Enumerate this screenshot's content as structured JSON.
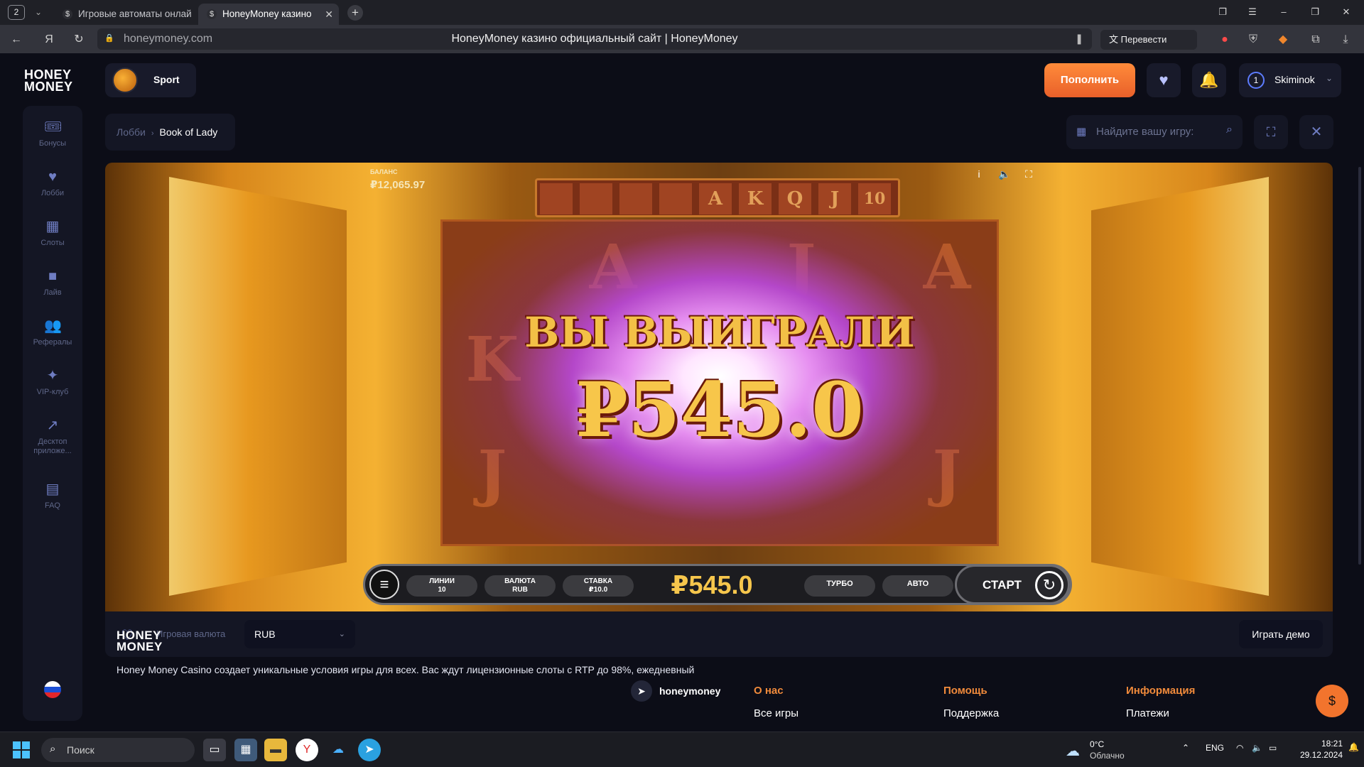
{
  "browser": {
    "tab_count": "2",
    "tabs": [
      {
        "title": "Игровые автоматы онлай",
        "favicon": "dollar-icon"
      },
      {
        "title": "HoneyMoney казино",
        "favicon": "dollar-icon"
      }
    ],
    "url": "honeymoney.com",
    "page_title": "HoneyMoney казино официальный сайт | HoneyMoney",
    "translate_label": "Перевести"
  },
  "header": {
    "logo_line1": "HONEY",
    "logo_line2": "MONEY",
    "sport_label": "Sport",
    "deposit_label": "Пополнить",
    "user": {
      "level": "1",
      "name": "Skiminok"
    }
  },
  "sidebar": {
    "items": [
      {
        "label": "Бонусы",
        "icon": "ticket-icon"
      },
      {
        "label": "Лобби",
        "icon": "heart-icon"
      },
      {
        "label": "Слоты",
        "icon": "grid-icon"
      },
      {
        "label": "Лайв",
        "icon": "camera-icon"
      },
      {
        "label": "Рефералы",
        "icon": "users-icon"
      },
      {
        "label": "VIP-клуб",
        "icon": "sparkle-icon"
      },
      {
        "label": "Десктоп приложе...",
        "icon": "external-link-icon"
      },
      {
        "label": "FAQ",
        "icon": "document-icon"
      }
    ],
    "language": "RU"
  },
  "breadcrumb": {
    "root": "Лобби",
    "current": "Book of Lady"
  },
  "search": {
    "placeholder": "Найдите вашу игру:"
  },
  "game": {
    "balance_label": "БАЛАНС",
    "balance_value": "₽12,065.97",
    "top_symbols": [
      "",
      "",
      "",
      "",
      "A",
      "K",
      "Q",
      "J",
      "10"
    ],
    "reel_symbols": [
      "A",
      "J",
      "A",
      "K",
      "J",
      "J"
    ],
    "win_title": "ВЫ ВЫИГРАЛИ",
    "win_amount": "₽545.0",
    "bar": {
      "lines_label": "ЛИНИИ",
      "lines_value": "10",
      "currency_label": "ВАЛЮТА",
      "currency_value": "RUB",
      "bet_label": "СТАВКА",
      "bet_value": "₽10.0",
      "win_display": "₽545.0",
      "turbo_label": "ТУРБО",
      "auto_label": "АВТО",
      "start_label": "СТАРТ"
    },
    "top_icons": {
      "info": "i"
    }
  },
  "game_footer": {
    "currency_label": "Игровая валюта",
    "currency_value": "RUB",
    "demo_label": "Играть демо"
  },
  "footer": {
    "description": "Honey Money Casino создает уникальные условия игры для всех. Вас ждут лицензионные слоты с RTP до 98%, ежедневный",
    "telegram_name": "honeymoney",
    "columns": [
      {
        "heading": "О нас",
        "link": "Все игры"
      },
      {
        "heading": "Помощь",
        "link": "Поддержка"
      },
      {
        "heading": "Информация",
        "link": "Платежи"
      }
    ]
  },
  "taskbar": {
    "search_placeholder": "Поиск",
    "weather_temp": "0°C",
    "weather_desc": "Облачно",
    "language": "ENG",
    "time": "18:21",
    "date": "29.12.2024"
  },
  "colors": {
    "accent": "#f08a3b",
    "deposit": "#ef6e2e",
    "panel": "#141624",
    "background": "#0c0d17",
    "gold": "#f6c64c"
  }
}
